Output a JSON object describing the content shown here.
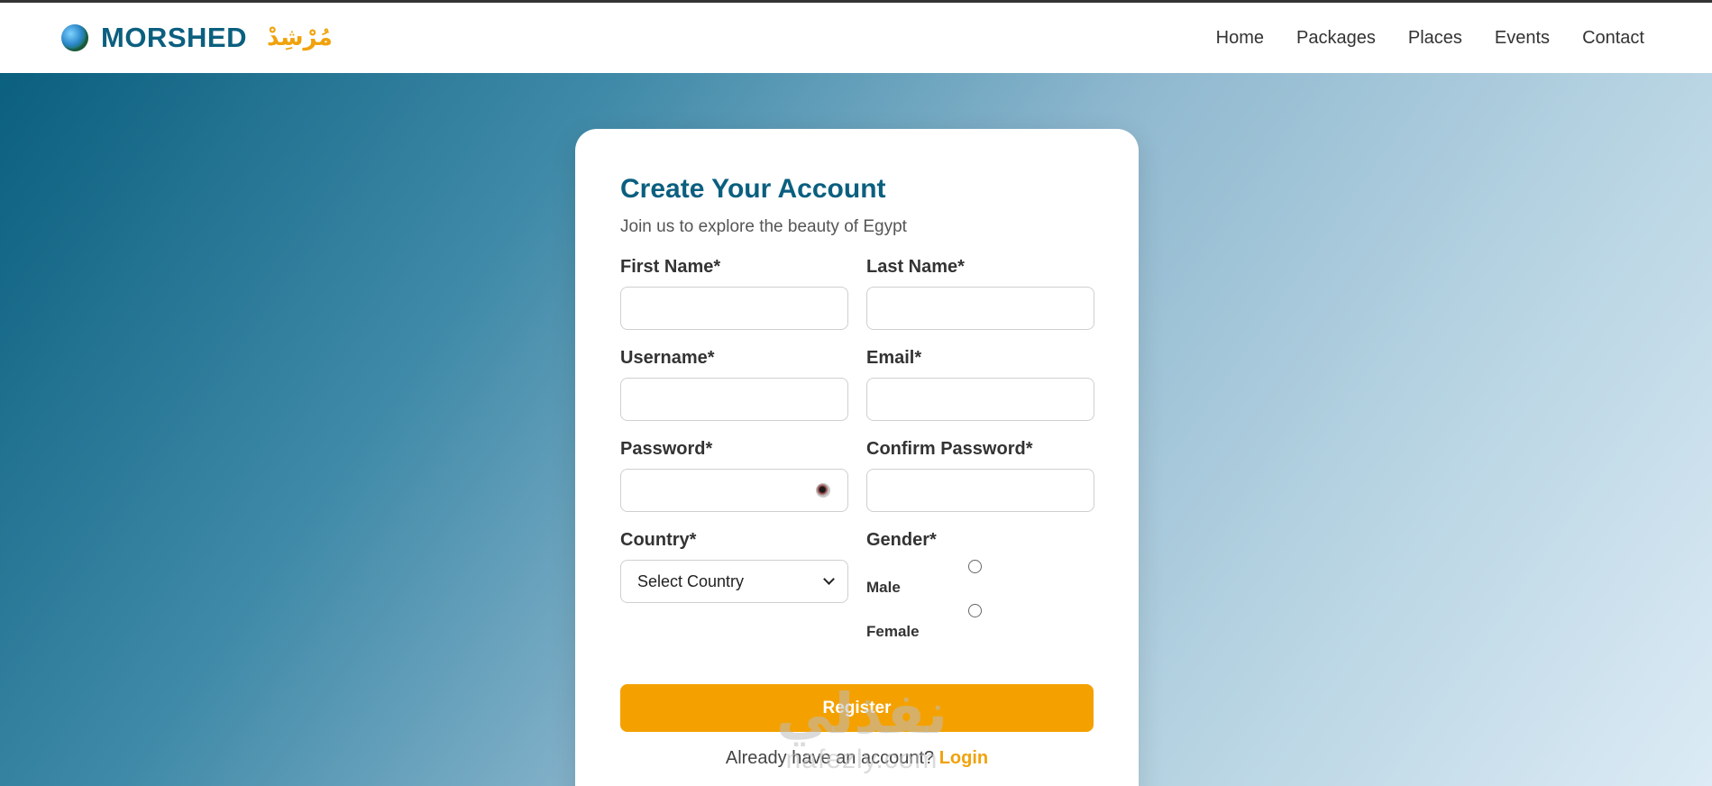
{
  "brand": {
    "name": "MORSHED",
    "arabic": "مُرْشِدْ",
    "globe_icon": "globe-icon"
  },
  "nav": {
    "items": [
      {
        "label": "Home"
      },
      {
        "label": "Packages"
      },
      {
        "label": "Places"
      },
      {
        "label": "Events"
      },
      {
        "label": "Contact"
      }
    ]
  },
  "form": {
    "title": "Create Your Account",
    "subtitle": "Join us to explore the beauty of Egypt",
    "first_name_label": "First Name*",
    "last_name_label": "Last Name*",
    "username_label": "Username*",
    "email_label": "Email*",
    "password_label": "Password*",
    "confirm_password_label": "Confirm Password*",
    "country_label": "Country*",
    "country_selected": "Select Country",
    "gender_label": "Gender*",
    "gender_options": [
      "Male",
      "Female"
    ],
    "register_label": "Register",
    "login_prompt": "Already have an account?",
    "login_link": "Login"
  },
  "watermark": {
    "arabic": "نفذلي",
    "latin": "nafezly.com"
  },
  "colors": {
    "brand_blue": "#0b5f7f",
    "accent_orange": "#f4a100"
  }
}
